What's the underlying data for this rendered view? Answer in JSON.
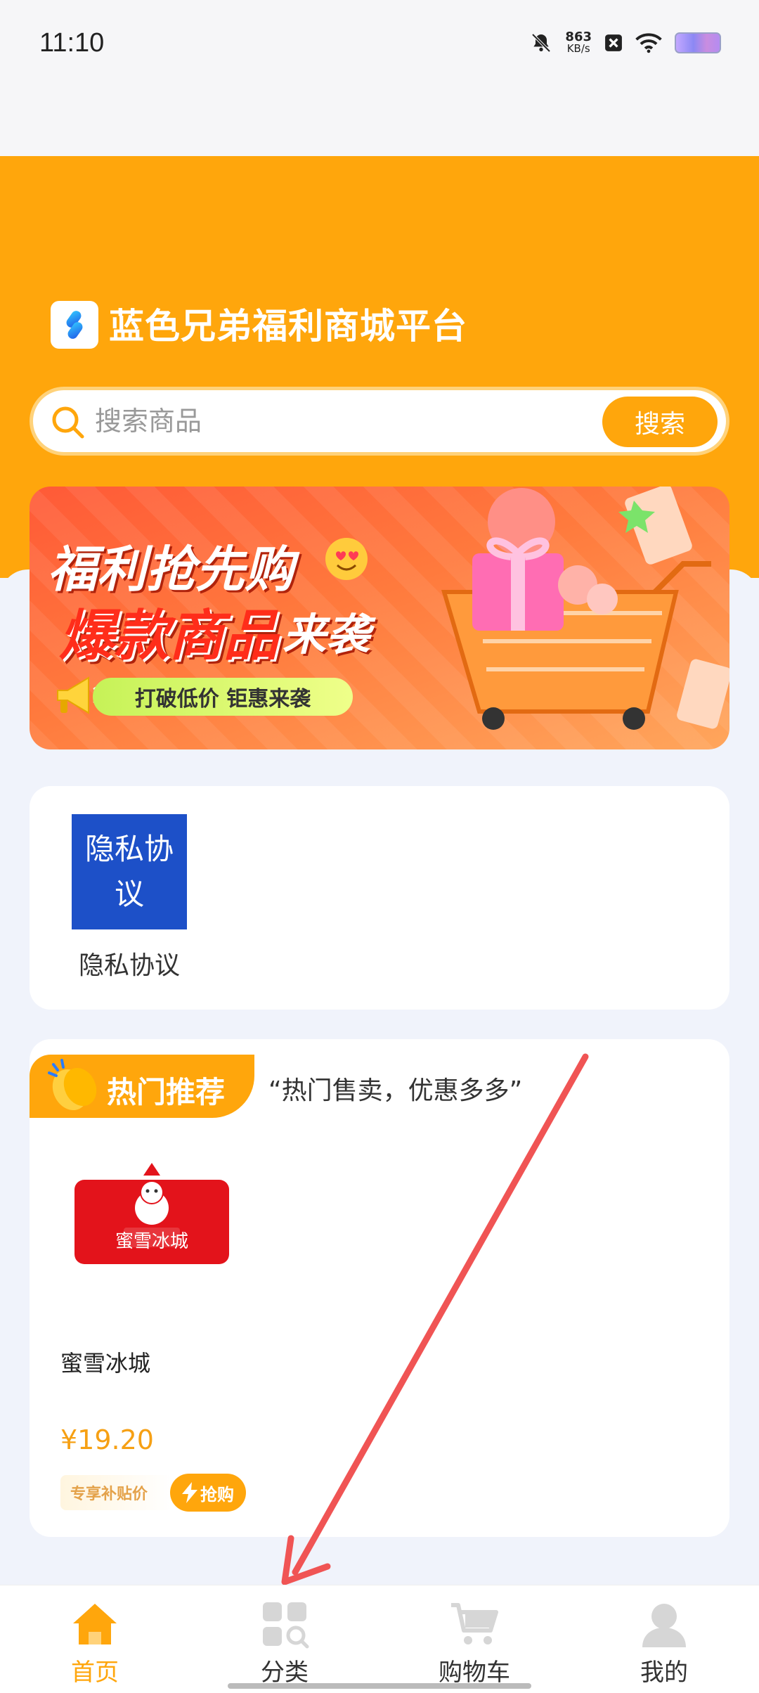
{
  "status_bar": {
    "time": "11:10",
    "net_speed_value": "863",
    "net_speed_unit": "KB/s"
  },
  "header": {
    "app_title": "蓝色兄弟福利商城平台",
    "logo_icon": "app-logo-icon"
  },
  "search": {
    "placeholder": "搜索商品",
    "button_label": "搜索"
  },
  "banner": {
    "line1": "福利抢先购",
    "line2": "爆款商品",
    "line2b": "来袭",
    "pill": "打破低价 钜惠来袭"
  },
  "privacy": {
    "tile_text": "隐私协议",
    "label": "隐私协议"
  },
  "hot": {
    "tag_title": "热门推荐",
    "slogan": "“热门售卖，优惠多多”",
    "products": [
      {
        "name": "蜜雪冰城",
        "logo_text": "蜜雪冰城",
        "price": "¥19.20",
        "subsidy_tag": "专享补贴价",
        "buy_label": "抢购"
      }
    ]
  },
  "tab_bar": {
    "items": [
      {
        "label": "首页",
        "icon": "home-icon",
        "active": true
      },
      {
        "label": "分类",
        "icon": "category-icon",
        "active": false
      },
      {
        "label": "购物车",
        "icon": "cart-icon",
        "active": false
      },
      {
        "label": "我的",
        "icon": "profile-icon",
        "active": false
      }
    ]
  },
  "colors": {
    "brand": "#ffa60c",
    "background": "#f0f3fb",
    "annotation_arrow": "#f05454"
  }
}
